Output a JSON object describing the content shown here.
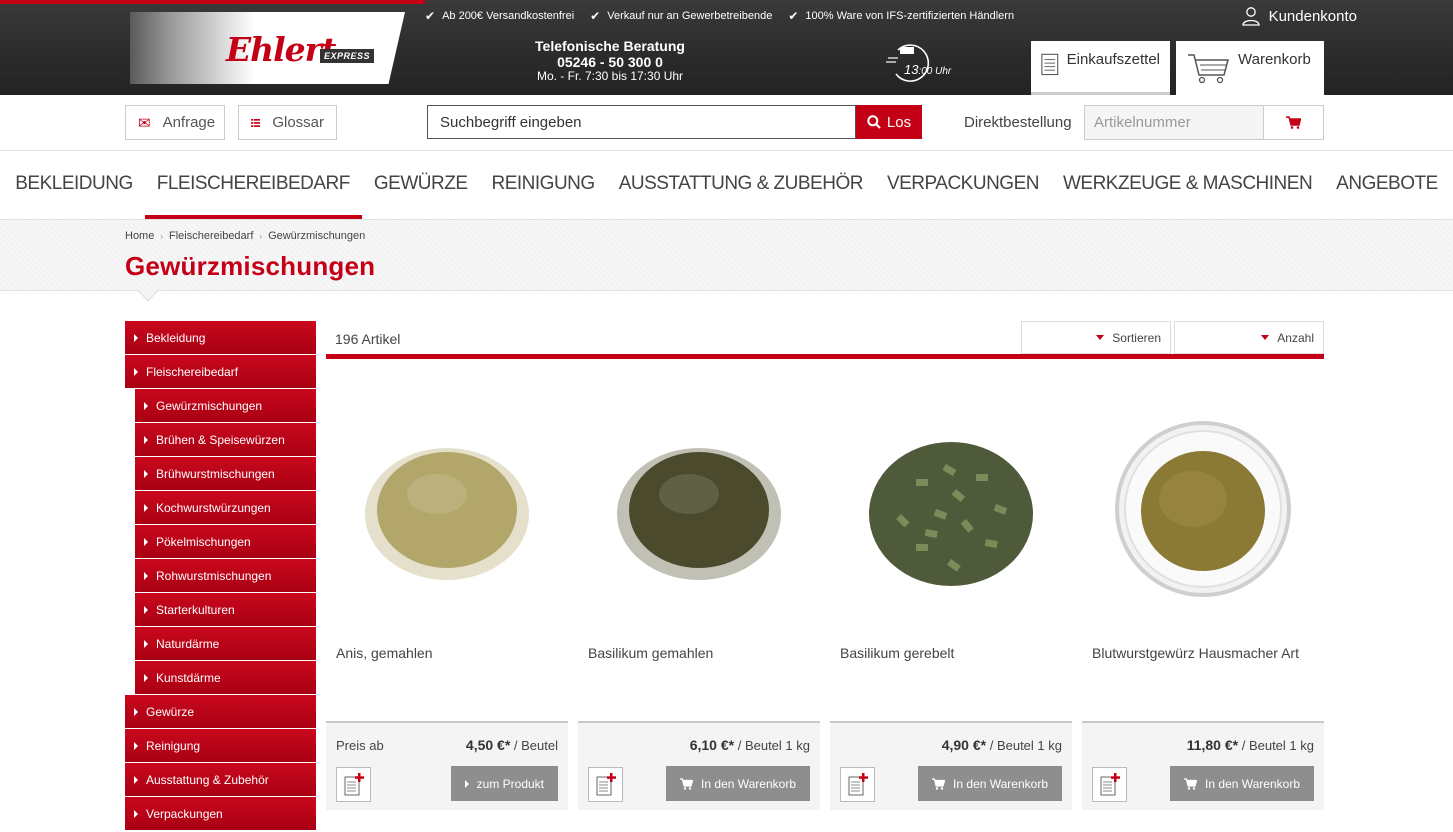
{
  "header": {
    "logo_text": "Ehlert",
    "logo_badge": "EXPRESS",
    "usp": [
      "Ab 200€ Versandkostenfrei",
      "Verkauf nur an Gewerbetreibende",
      "100% Ware von IFS-zertifizierten Händlern"
    ],
    "account_label": "Kundenkonto",
    "hotline_title": "Telefonische Beratung",
    "hotline_number": "05246 - 50 300 0",
    "hotline_hours": "Mo. - Fr. 7:30 bis 17:30 Uhr",
    "clock_hour": "13",
    "clock_rest": ":00 Uhr",
    "list_label": "Einkaufszettel",
    "cart_label": "Warenkorb"
  },
  "subbar": {
    "anfrage_label": "Anfrage",
    "glossar_label": "Glossar",
    "search_placeholder": "Suchbegriff eingeben",
    "search_button": "Los",
    "direct_label": "Direktbestellung",
    "direct_placeholder": "Artikelnummer"
  },
  "nav": [
    "BEKLEIDUNG",
    "FLEISCHEREIBEDARF",
    "GEWÜRZE",
    "REINIGUNG",
    "AUSSTATTUNG & ZUBEHÖR",
    "VERPACKUNGEN",
    "WERKZEUGE & MASCHINEN",
    "ANGEBOTE"
  ],
  "nav_active": 1,
  "breadcrumb": [
    "Home",
    "Fleischereibedarf",
    "Gewürzmischungen"
  ],
  "page_title": "Gewürzmischungen",
  "sidebar": [
    {
      "label": "Bekleidung",
      "sub": false
    },
    {
      "label": "Fleischereibedarf",
      "sub": false
    },
    {
      "label": "Gewürzmischungen",
      "sub": true
    },
    {
      "label": "Brühen & Speisewürzen",
      "sub": true
    },
    {
      "label": "Brühwurstmischungen",
      "sub": true
    },
    {
      "label": "Kochwurstwürzungen",
      "sub": true
    },
    {
      "label": "Pökelmischungen",
      "sub": true
    },
    {
      "label": "Rohwurstmischungen",
      "sub": true
    },
    {
      "label": "Starterkulturen",
      "sub": true
    },
    {
      "label": "Naturdärme",
      "sub": true
    },
    {
      "label": "Kunstdärme",
      "sub": true
    },
    {
      "label": "Gewürze",
      "sub": false
    },
    {
      "label": "Reinigung",
      "sub": false
    },
    {
      "label": "Ausstattung & Zubehör",
      "sub": false
    },
    {
      "label": "Verpackungen",
      "sub": false
    }
  ],
  "listing": {
    "count": "196 Artikel",
    "sort_label": "Sortieren",
    "amount_label": "Anzahl"
  },
  "products": [
    {
      "name": "Anis, gemahlen",
      "price_prefix": "Preis ab",
      "price": "4,50 €*",
      "unit": "/ Beutel",
      "cta": "zum Produkt",
      "cta_icon": "chevron-right-icon",
      "color": "#b3a66a",
      "kind": "powder"
    },
    {
      "name": "Basilikum gemahlen",
      "price_prefix": "",
      "price": "6,10 €*",
      "unit": "/ Beutel 1 kg",
      "cta": "In den Warenkorb",
      "cta_icon": "cart-icon",
      "color": "#4b4a2c",
      "kind": "powder"
    },
    {
      "name": "Basilikum gerebelt",
      "price_prefix": "",
      "price": "4,90 €*",
      "unit": "/ Beutel 1 kg",
      "cta": "In den Warenkorb",
      "cta_icon": "cart-icon",
      "color": "#4f5a3a",
      "kind": "flakes"
    },
    {
      "name": "Blutwurstgewürz Hausmacher Art",
      "price_prefix": "",
      "price": "11,80 €*",
      "unit": "/ Beutel 1 kg",
      "cta": "In den Warenkorb",
      "cta_icon": "cart-icon",
      "color": "#8b7a35",
      "kind": "bowl"
    }
  ],
  "colors": {
    "brand": "#c40016",
    "cta": "#8e8e8e"
  }
}
